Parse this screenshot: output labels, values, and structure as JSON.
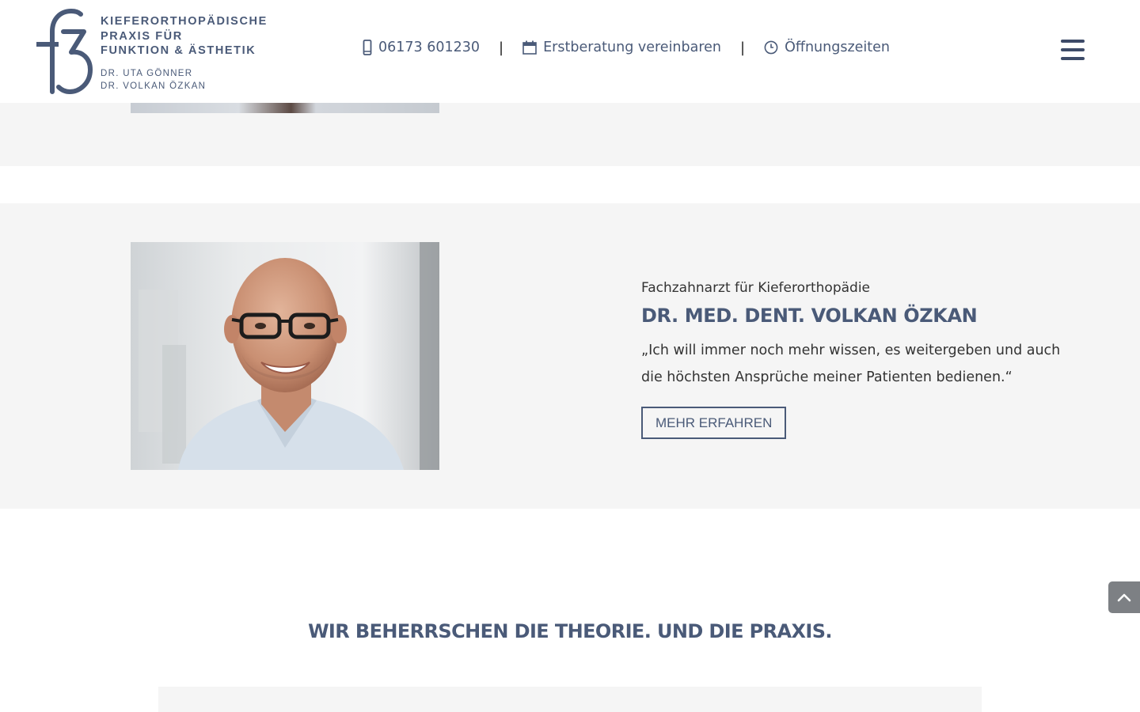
{
  "brand": {
    "name_lines": [
      "KIEFERORTHOPÄDISCHE",
      "PRAXIS FÜR",
      "FUNKTION & ÄSTHETIK"
    ],
    "doctor_lines": [
      "DR. UTA GÖNNER",
      "DR. VOLKAN ÖZKAN"
    ],
    "color": "#4a5a78"
  },
  "nav": {
    "phone": "06173 601230",
    "appointment": "Erstberatung vereinbaren",
    "hours": "Öffnungszeiten",
    "separator": "|"
  },
  "profile": {
    "subtitle": "Fachzahnarzt für Kieferorthopädie",
    "name": "DR. MED. DENT. VOLKAN ÖZKAN",
    "quote": "„Ich will immer noch mehr wissen, es weitergeben und auch die höchsten Ansprüche meiner Patienten bedienen.“",
    "button": "MEHR ERFAHREN"
  },
  "section": {
    "title": "WIR BEHERRSCHEN DIE THEORIE. UND DIE PRAXIS."
  },
  "colors": {
    "accent": "#4a5a78",
    "band": "#f5f5f5",
    "to_top": "#7d8084"
  }
}
